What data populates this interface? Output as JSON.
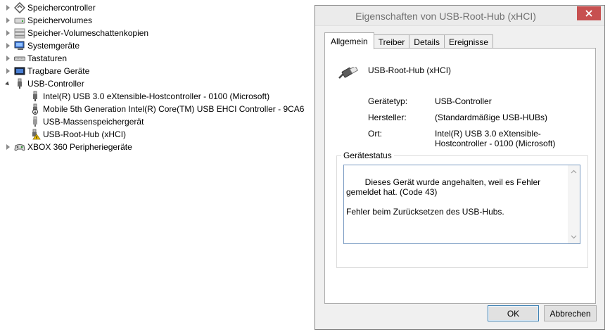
{
  "tree": {
    "items": [
      {
        "label": "Speichercontroller",
        "icon": "storage-controller-icon",
        "level": 0,
        "state": "collapsed"
      },
      {
        "label": "Speichervolumes",
        "icon": "storage-volume-icon",
        "level": 0,
        "state": "collapsed"
      },
      {
        "label": "Speicher-Volumeschattenkopien",
        "icon": "shadow-copy-icon",
        "level": 0,
        "state": "collapsed"
      },
      {
        "label": "Systemgeräte",
        "icon": "system-devices-icon",
        "level": 0,
        "state": "collapsed"
      },
      {
        "label": "Tastaturen",
        "icon": "keyboard-icon",
        "level": 0,
        "state": "collapsed"
      },
      {
        "label": "Tragbare Geräte",
        "icon": "portable-device-icon",
        "level": 0,
        "state": "collapsed"
      },
      {
        "label": "USB-Controller",
        "icon": "usb-icon",
        "level": 0,
        "state": "expanded"
      },
      {
        "label": "Intel(R) USB 3.0 eXtensible-Hostcontroller - 0100 (Microsoft)",
        "icon": "usb-icon",
        "level": 1
      },
      {
        "label": "Mobile 5th Generation Intel(R) Core(TM) USB EHCI Controller - 9CA6",
        "icon": "usb-download-icon",
        "level": 1
      },
      {
        "label": "USB-Massenspeichergerät",
        "icon": "usb-icon",
        "level": 1
      },
      {
        "label": "USB-Root-Hub (xHCI)",
        "icon": "usb-warning-icon",
        "level": 1
      },
      {
        "label": "XBOX 360 Peripheriegeräte",
        "icon": "gamepad-icon",
        "level": 0,
        "state": "collapsed"
      }
    ]
  },
  "dialog": {
    "title": "Eigenschaften von USB-Root-Hub (xHCI)",
    "tabs": [
      "Allgemein",
      "Treiber",
      "Details",
      "Ereignisse"
    ],
    "active_tab": "Allgemein",
    "device_name": "USB-Root-Hub (xHCI)",
    "props": {
      "type_label": "Gerätetyp:",
      "type_value": "USB-Controller",
      "maker_label": "Hersteller:",
      "maker_value": "(Standardmäßige USB-HUBs)",
      "location_label": "Ort:",
      "location_value": "Intel(R) USB 3.0 eXtensible-Hostcontroller - 0100 (Microsoft)"
    },
    "status_title": "Gerätestatus",
    "status_text": "Dieses Gerät wurde angehalten, weil es Fehler gemeldet hat. (Code 43)\n\nFehler beim Zurücksetzen des USB-Hubs.",
    "ok_label": "OK",
    "cancel_label": "Abbrechen"
  },
  "colors": {
    "close_button": "#c75050",
    "accent_border": "#3c7fb1",
    "warning": "#f2c200"
  }
}
